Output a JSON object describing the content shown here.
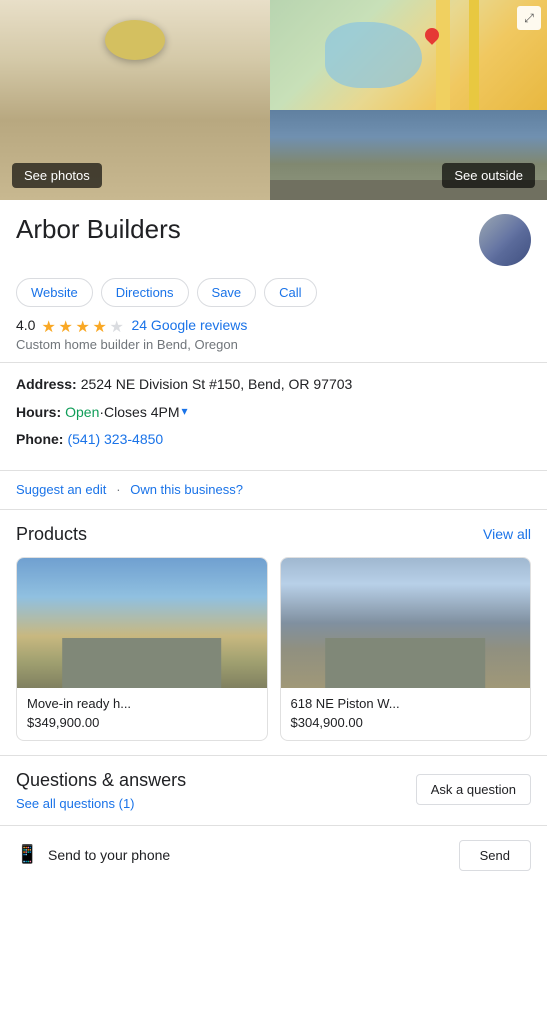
{
  "hero": {
    "see_photos_label": "See photos",
    "see_outside_label": "See outside",
    "map_expand_icon": "⤢"
  },
  "business": {
    "name": "Arbor Builders",
    "rating": "4.0",
    "reviews_text": "24 Google reviews",
    "business_type": "Custom home builder in Bend, Oregon",
    "address_label": "Address:",
    "address_value": "2524 NE Division St #150, Bend, OR 97703",
    "hours_label": "Hours:",
    "status_open": "Open",
    "status_dot": " · ",
    "status_close": "Closes 4PM",
    "hours_toggle": "▾",
    "phone_label": "Phone:",
    "phone_value": "(541) 323-4850",
    "suggest_edit": "Suggest an edit",
    "separator": " · ",
    "own_business": "Own this business?"
  },
  "action_buttons": [
    {
      "label": "Website",
      "name": "website-button"
    },
    {
      "label": "Directions",
      "name": "directions-button"
    },
    {
      "label": "Save",
      "name": "save-button"
    },
    {
      "label": "Call",
      "name": "call-button"
    }
  ],
  "products": {
    "title": "Products",
    "view_all": "View all",
    "items": [
      {
        "name": "Move-in ready h...",
        "price": "$349,900.00"
      },
      {
        "name": "618 NE Piston W...",
        "price": "$304,900.00"
      }
    ]
  },
  "qa": {
    "title": "Questions & answers",
    "see_all": "See all questions (1)",
    "ask_button": "Ask a question"
  },
  "send": {
    "label": "Send to your phone",
    "button": "Send"
  }
}
